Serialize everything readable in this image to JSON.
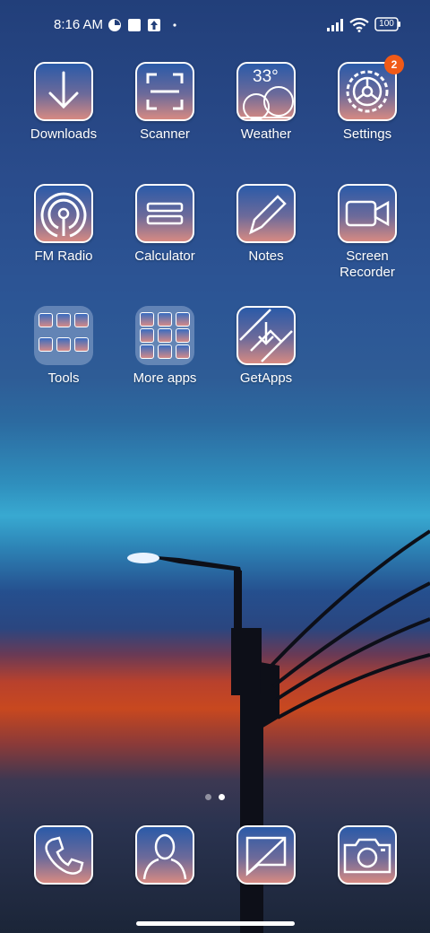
{
  "status_bar": {
    "time": "8:16 AM",
    "battery": "100",
    "icons": [
      "notification-app-icon",
      "notification-square-icon",
      "upload-icon",
      "dot-icon",
      "signal-icon",
      "wifi-icon",
      "battery-icon"
    ]
  },
  "apps": [
    {
      "label": "Downloads",
      "icon": "download-icon"
    },
    {
      "label": "Scanner",
      "icon": "scanner-icon"
    },
    {
      "label": "Weather",
      "icon": "weather-icon",
      "temp": "33°"
    },
    {
      "label": "Settings",
      "icon": "gear-icon",
      "badge": "2"
    },
    {
      "label": "FM Radio",
      "icon": "radio-icon"
    },
    {
      "label": "Calculator",
      "icon": "calculator-icon"
    },
    {
      "label": "Notes",
      "icon": "pencil-icon"
    },
    {
      "label": "Screen Recorder",
      "icon": "video-camera-icon"
    },
    {
      "label": "Tools",
      "icon": "folder"
    },
    {
      "label": "More apps",
      "icon": "folder"
    },
    {
      "label": "GetApps",
      "icon": "getapps-icon"
    }
  ],
  "dock": [
    {
      "name": "phone",
      "icon": "phone-icon"
    },
    {
      "name": "contacts",
      "icon": "contacts-icon"
    },
    {
      "name": "messages",
      "icon": "message-icon"
    },
    {
      "name": "camera",
      "icon": "camera-icon"
    }
  ],
  "pager": {
    "pages": 2,
    "current": 2
  },
  "colors": {
    "badge": "#f05a18",
    "tile_border": "#ffffff"
  }
}
